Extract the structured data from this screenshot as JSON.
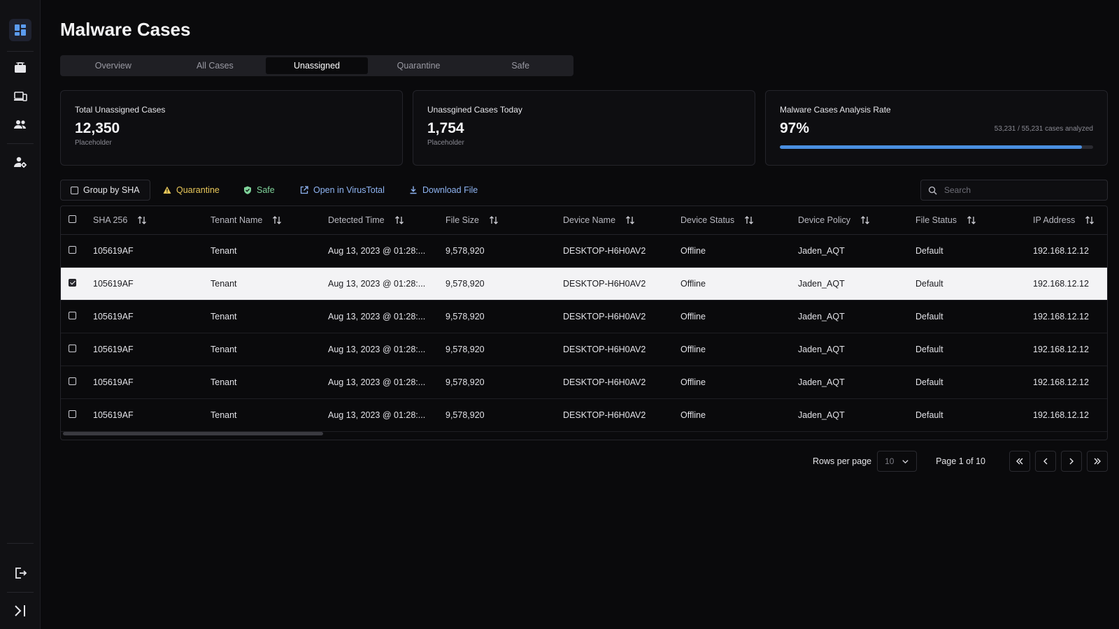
{
  "app": {
    "title": "Malware Cases"
  },
  "sidebar": {
    "items": [
      {
        "icon": "dashboard-icon"
      },
      {
        "icon": "briefcase-icon"
      },
      {
        "icon": "devices-icon"
      },
      {
        "icon": "users-icon"
      },
      {
        "icon": "user-settings-icon"
      }
    ],
    "bottom": [
      {
        "icon": "logout-icon"
      },
      {
        "icon": "expand-sidebar-icon"
      }
    ]
  },
  "tabs": [
    {
      "label": "Overview",
      "active": false
    },
    {
      "label": "All Cases",
      "active": false
    },
    {
      "label": "Unassigned",
      "active": true
    },
    {
      "label": "Quarantine",
      "active": false
    },
    {
      "label": "Safe",
      "active": false
    }
  ],
  "cards": {
    "total": {
      "title": "Total Unassigned Cases",
      "value": "12,350",
      "sub": "Placeholder"
    },
    "today": {
      "title": "Unassgined Cases Today",
      "value": "1,754",
      "sub": "Placeholder"
    },
    "rate": {
      "title": "Malware Cases Analysis Rate",
      "value": "97%",
      "detail": "53,231 / 55,231 cases analyzed",
      "progress": 0.964
    }
  },
  "toolbar": {
    "group_label": "Group by SHA",
    "quarantine_label": "Quarantine",
    "safe_label": "Safe",
    "virustotal_label": "Open in VirusTotal",
    "download_label": "Download File",
    "search_placeholder": "Search"
  },
  "colors": {
    "warning": "#e9c85a",
    "success": "#7fd39a",
    "link": "#8fb4f2",
    "accent": "#4a8fe0"
  },
  "table": {
    "columns": [
      "SHA 256",
      "Tenant Name",
      "Detected Time",
      "File Size",
      "Device Name",
      "Device Status",
      "Device Policy",
      "File Status",
      "IP Address"
    ],
    "rows": [
      {
        "selected": false,
        "cells": [
          "105619AF",
          "Tenant",
          "Aug 13, 2023 @ 01:28:...",
          "9,578,920",
          "DESKTOP-H6H0AV2",
          "Offline",
          "Jaden_AQT",
          "Default",
          "192.168.12.12"
        ]
      },
      {
        "selected": true,
        "cells": [
          "105619AF",
          "Tenant",
          "Aug 13, 2023 @ 01:28:...",
          "9,578,920",
          "DESKTOP-H6H0AV2",
          "Offline",
          "Jaden_AQT",
          "Default",
          "192.168.12.12"
        ]
      },
      {
        "selected": false,
        "cells": [
          "105619AF",
          "Tenant",
          "Aug 13, 2023 @ 01:28:...",
          "9,578,920",
          "DESKTOP-H6H0AV2",
          "Offline",
          "Jaden_AQT",
          "Default",
          "192.168.12.12"
        ]
      },
      {
        "selected": false,
        "cells": [
          "105619AF",
          "Tenant",
          "Aug 13, 2023 @ 01:28:...",
          "9,578,920",
          "DESKTOP-H6H0AV2",
          "Offline",
          "Jaden_AQT",
          "Default",
          "192.168.12.12"
        ]
      },
      {
        "selected": false,
        "cells": [
          "105619AF",
          "Tenant",
          "Aug 13, 2023 @ 01:28:...",
          "9,578,920",
          "DESKTOP-H6H0AV2",
          "Offline",
          "Jaden_AQT",
          "Default",
          "192.168.12.12"
        ]
      },
      {
        "selected": false,
        "cells": [
          "105619AF",
          "Tenant",
          "Aug 13, 2023 @ 01:28:...",
          "9,578,920",
          "DESKTOP-H6H0AV2",
          "Offline",
          "Jaden_AQT",
          "Default",
          "192.168.12.12"
        ]
      }
    ]
  },
  "pagination": {
    "rows_per_page_label": "Rows per page",
    "rows_per_page_value": "10",
    "page_label": "Page 1 of 10"
  }
}
